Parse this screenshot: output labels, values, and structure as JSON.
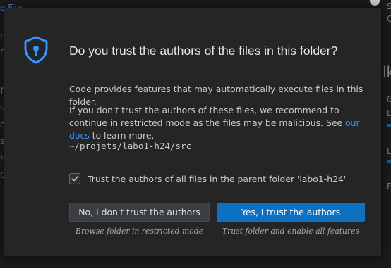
{
  "background": {
    "fragments": [
      "e File",
      "n",
      "n",
      "s",
      "o",
      "s",
      "s",
      "lk",
      "G",
      "D",
      "L",
      "E"
    ]
  },
  "dialog": {
    "title": "Do you trust the authors of the files in this folder?",
    "icon": "shield-lock-icon",
    "paragraph1": "Code provides features that may automatically execute files in this folder.",
    "paragraph2_before": "If you don't trust the authors of these files, we recommend to continue in restricted mode as the files may be malicious. See ",
    "paragraph2_link": "our docs",
    "paragraph2_after": " to learn more.",
    "path": "~/projets/labo1-h24/src",
    "checkbox": {
      "checked": true,
      "label": "Trust the authors of all files in the parent folder 'labo1-h24'"
    },
    "buttons": {
      "no_label": "No, I don't trust the authors",
      "no_description": "Browse folder in restricted mode",
      "yes_label": "Yes, I trust the authors",
      "yes_description": "Trust folder and enable all features"
    }
  },
  "colors": {
    "dialog_bg": "#252526",
    "primary_button": "#0e70c0",
    "link": "#3794ff",
    "icon": "#3794ff"
  }
}
